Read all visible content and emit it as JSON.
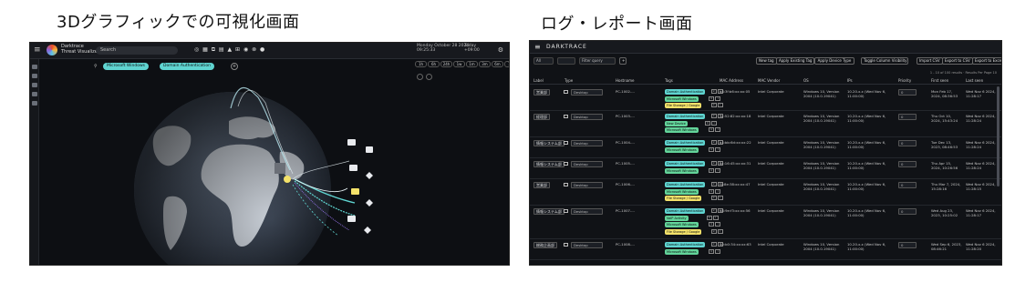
{
  "captions": {
    "left": "3Dグラフィックでの可視化画面",
    "right": "ログ・レポート画面"
  },
  "visualizer": {
    "brand": "Darktrace\nThreat Visualizer",
    "search": "Search",
    "filters": [
      "Microsoft Windows",
      "Domain Authentication"
    ],
    "date": "Monday October 28 2024\n09:25:33",
    "time_label": "Today\n+09:00",
    "toolbar_buttons": [
      "1h",
      "6h",
      "24h",
      "1w",
      "1m",
      "3m",
      "6m",
      "1y"
    ],
    "colors": {
      "background": "#0d0f13",
      "ocean": "#3b4452",
      "land": "#c8ced6",
      "connection": "#5fd4d0",
      "node_highlight": "#f4e26a"
    }
  },
  "report": {
    "brand": "DARKTRACE",
    "toolbar": {
      "selects": [
        "All",
        "Filter query"
      ],
      "buttons": [
        "New tag",
        "Apply Existing Tag",
        "Apply Device Type",
        "Toggle Column Visibility",
        "Import CSV",
        "Export to CSV",
        "Export to Excel"
      ]
    },
    "pagination": "1 - 10 of 100 results  ·  Results Per Page  10",
    "columns": [
      "Label",
      "Type",
      "Hostname",
      "Tags",
      "MAC Address",
      "MAC Vendor",
      "OS",
      "IPs",
      "Priority",
      "First seen",
      "Last seen"
    ],
    "rows": [
      {
        "label": "営業部",
        "type": "Desktop",
        "hostname": "PC-1002-...",
        "tags": [
          "Domain Authentication",
          "Microsoft Windows",
          "File Storage / Google"
        ],
        "mac": "a8:3f:b6:xx:xx:05",
        "vendor": "Intel Corporate",
        "os": "Windows 10, Version 2004 (10.0.19041)",
        "ips": "10.20.x.x (Wed Nov 6, 11:00:00)",
        "priority": "0",
        "first_seen": "Mon Feb 17, 2024, 08:36:53",
        "last_seen": "Wed Nov 6 2024, 11:28:17"
      },
      {
        "label": "経理部",
        "type": "Desktop",
        "hostname": "PC-1003-...",
        "tags": [
          "Domain Authentication",
          "New Device",
          "Microsoft Windows"
        ],
        "mac": "3c:52:82:xx:xx:18",
        "vendor": "Intel Corporate",
        "os": "Windows 10, Version 2004 (10.0.19041)",
        "ips": "10.20.x.x (Wed Nov 6, 11:00:00)",
        "priority": "0",
        "first_seen": "Thu Oct 10, 2024, 15:43:24",
        "last_seen": "Wed Nov 6 2024, 11:28:24"
      },
      {
        "label": "情報システム部",
        "type": "Desktop",
        "hostname": "PC-1004-...",
        "tags": [
          "Domain Authentication",
          "Microsoft Windows"
        ],
        "mac": "a4:bb:6d:xx:xx:22",
        "vendor": "Intel Corporate",
        "os": "Windows 10, Version 2004 (10.0.19041)",
        "ips": "10.20.x.x (Wed Nov 6, 11:00:00)",
        "priority": "0",
        "first_seen": "Tue Dec 13, 2023, 08:46:53",
        "last_seen": "Wed Nov 6 2024, 11:28:24"
      },
      {
        "label": "情報システム部",
        "type": "Desktop",
        "hostname": "PC-1005-...",
        "tags": [
          "Domain Authentication",
          "Microsoft Windows"
        ],
        "mac": "8c:16:45:xx:xx:31",
        "vendor": "Intel Corporate",
        "os": "Windows 10, Version 2004 (10.0.19041)",
        "ips": "10.20.x.x (Wed Nov 6, 11:00:00)",
        "priority": "0",
        "first_seen": "Thu Apr 15, 2024, 10:26:56",
        "last_seen": "Wed Nov 6 2024, 11:28:24"
      },
      {
        "label": "営業部",
        "type": "Desktop",
        "hostname": "PC-1006-...",
        "tags": [
          "Domain Authentication",
          "Microsoft Windows",
          "File Storage / Google"
        ],
        "mac": "f4:8e:38:xx:xx:47",
        "vendor": "Intel Corporate",
        "os": "Windows 10, Version 2004 (10.0.19041)",
        "ips": "10.20.x.x (Wed Nov 6, 11:00:00)",
        "priority": "0",
        "first_seen": "Thu Mar 7, 2024, 15:28:16",
        "last_seen": "Wed Nov 6 2024, 11:28:15"
      },
      {
        "label": "情報システム部",
        "type": "Desktop",
        "hostname": "PC-1007-...",
        "tags": [
          "Domain Authentication",
          "VoIP Activity",
          "Microsoft Windows",
          "File Storage / Google"
        ],
        "mac": "d8:9e:f3:xx:xx:56",
        "vendor": "Intel Corporate",
        "os": "Windows 10, Version 2004 (10.0.19041)",
        "ips": "10.20.x.x (Wed Nov 6, 11:00:00)",
        "priority": "0",
        "first_seen": "Wed Aug 23, 2023, 10:25:02",
        "last_seen": "Wed Nov 6 2024, 11:28:17"
      },
      {
        "label": "総務企画部",
        "type": "Desktop",
        "hostname": "PC-1008-...",
        "tags": [
          "Domain Authentication",
          "Microsoft Windows"
        ],
        "mac": "40:b0:34:xx:xx:63",
        "vendor": "Intel Corporate",
        "os": "Windows 10, Version 2004 (10.0.19041)",
        "ips": "10.20.x.x (Wed Nov 6, 11:00:00)",
        "priority": "0",
        "first_seen": "Wed Sep 6, 2023, 08:46:21",
        "last_seen": "Wed Nov 6 2024, 11:28:20"
      }
    ],
    "tag_colors": {
      "Domain Authentication": "#5fd4d0",
      "Microsoft Windows": "#63d49a",
      "New Device": "#63d49a",
      "VoIP Activity": "#63d49a",
      "File Storage / Google": "#f4e26a"
    }
  }
}
